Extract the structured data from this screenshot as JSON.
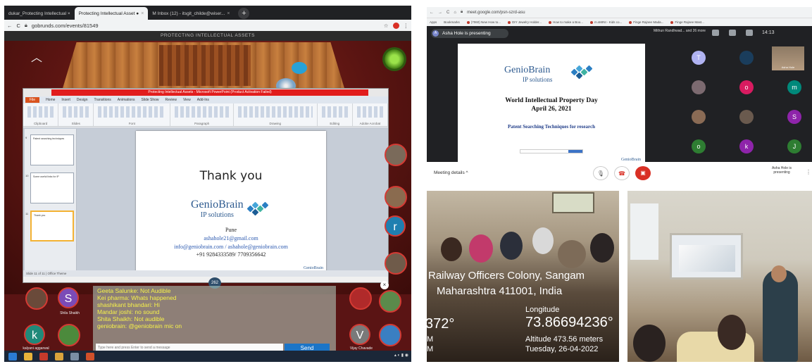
{
  "left_browser": {
    "tabs": [
      {
        "label": "dukar_Protecting Intellectual ×",
        "active": false
      },
      {
        "label": "Protecting Intellectual Asset ●",
        "active": true
      },
      {
        "label": "M Inbox (12) - itsgit_childe@wiser...",
        "active": false
      }
    ],
    "url": "gobrunds.com/events/81549",
    "stage_title": "PROTECTING INTELLECTUAL ASSETS"
  },
  "ppt": {
    "window_title": "Protecting Intellectual Assets - Microsoft PowerPoint (Product Activation Failed)",
    "tabs": [
      "File",
      "Home",
      "Insert",
      "Design",
      "Transitions",
      "Animations",
      "Slide Show",
      "Review",
      "View",
      "Add-Ins"
    ],
    "ribbon_groups": [
      "Clipboard",
      "Slides",
      "Font",
      "Paragraph",
      "Drawing",
      "Editing",
      "Adobe Acrobat"
    ],
    "thumbnails": [
      {
        "num": "9",
        "text": "Patent searching techniques"
      },
      {
        "num": "10",
        "text": "Some useful links for IP"
      },
      {
        "num": "11",
        "text": "Thank you"
      }
    ],
    "slide": {
      "heading": "Thank you",
      "logo_main": "GenioBrain",
      "logo_sub": "IP solutions",
      "city": "Pune",
      "email1": "ashahole21@gmail.com",
      "email2": "info@geniobrain.com / ashahole@geniobrain.com",
      "phone": "+91 9284333589/ 7709356642"
    },
    "status": "Slide 11 of 11 | Office Theme",
    "count_badge": "262"
  },
  "chat": {
    "lines": [
      "Geeta Salunke: Not Audible",
      "Kei pharma: Whats happened",
      "shashikant bhandari: Hi",
      "Mandar joshi: no sound",
      "Shita Shaikh: Not audible",
      "geniobrain: @geniobrain mic on"
    ],
    "input_placeholder": "Type here and press Enter to send a message",
    "send_label": "Send"
  },
  "left_avatars": [
    {
      "letter": "S",
      "label": "Shila Shaikh",
      "color": "#7b4bb7"
    },
    {
      "letter": "k",
      "label": "kalyani aggarwal",
      "color": "#1f8a7a"
    },
    {
      "letter": "r",
      "label": "",
      "color": "#1f7fb0"
    },
    {
      "letter": "V",
      "label": "Vijay Chavade",
      "color": "#7a7a7a"
    }
  ],
  "meet": {
    "url": "meet.google.com/psn-szrd-asu",
    "bookmarks": [
      "Apps",
      "Bookmarks",
      "(7060) New How to...",
      "DIY Jewelry Holder...",
      "How to make a Boo...",
      "m.sMINI - Kids co...",
      "Finge Rajnee Mada...",
      "Finge Rajnee Mast..."
    ],
    "presenting": "Asha Hole is presenting",
    "presenting_initial": "A",
    "others": "Mithun Randhwad... and 26 more",
    "time": "14:13",
    "slide": {
      "logo_main": "GenioBrain",
      "logo_sub": "IP solutions",
      "title": "World Intellectual Property Day",
      "date": "April 26, 2021",
      "subtitle": "Patent Searching Techniques for research"
    },
    "self_label": "Asha Hole",
    "tiles": [
      {
        "letter": "T",
        "color": "#b0b3f2"
      },
      {
        "letter": "o",
        "color": "#d81b60"
      },
      {
        "letter": "m",
        "color": "#00897b"
      },
      {
        "letter": "S",
        "color": "#8e24aa"
      },
      {
        "letter": "o",
        "color": "#2e7d32"
      },
      {
        "letter": "k",
        "color": "#8e24aa"
      },
      {
        "letter": "J",
        "color": "#2e7d32"
      }
    ],
    "meeting_details": "Meeting details  ^",
    "presenting_label": "Asha Hole is presenting"
  },
  "photo1": {
    "address_line1": "Railway Officers Colony, Sangam",
    "address_line2": "Maharashtra 411001, India",
    "lat_fragment": "372°",
    "longitude_label": "Longitude",
    "longitude": "73.86694236°",
    "altitude": "Altitude 473.56 meters",
    "date": "Tuesday, 26-04-2022",
    "frag1": "M",
    "frag2": "M"
  },
  "colors": {
    "send_button": "#1c75c7",
    "chat_text": "#f7f24a",
    "meet_bg": "#202124",
    "hangup_red": "#d93025"
  }
}
